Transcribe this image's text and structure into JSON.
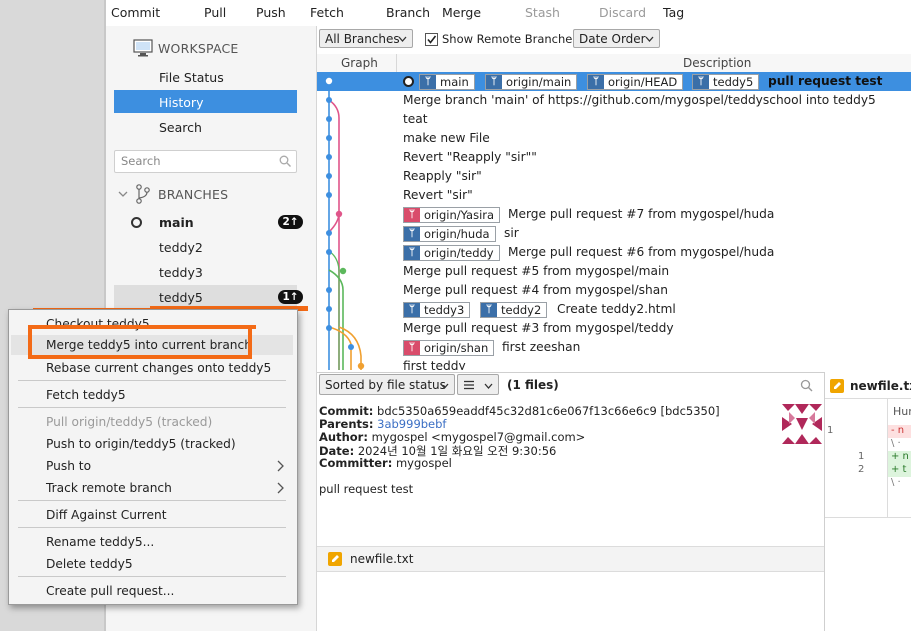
{
  "toolbar": {
    "items": [
      "Commit",
      "Pull",
      "Push",
      "Fetch",
      "Branch",
      "Merge",
      "Stash",
      "Discard",
      "Tag"
    ]
  },
  "sidebar": {
    "workspace_title": "WORKSPACE",
    "items": [
      "File Status",
      "History",
      "Search"
    ],
    "selected": "History",
    "search_placeholder": "Search",
    "branches_title": "BRANCHES",
    "branches": [
      {
        "name": "main",
        "current": true,
        "badge": "2↑"
      },
      {
        "name": "teddy2"
      },
      {
        "name": "teddy3"
      },
      {
        "name": "teddy5",
        "badge": "1↑"
      }
    ]
  },
  "filters": {
    "branches": "All Branches",
    "show_remote_label": "Show Remote Branches",
    "show_remote_checked": true,
    "order": "Date Order"
  },
  "columns": {
    "graph": "Graph",
    "description": "Description"
  },
  "commits": [
    {
      "tags": [
        {
          "label": "main",
          "kind": "local"
        },
        {
          "label": "origin/main",
          "kind": "remote"
        },
        {
          "label": "origin/HEAD",
          "kind": "remote"
        },
        {
          "label": "teddy5",
          "kind": "local"
        }
      ],
      "message": "pull request test",
      "selected": true
    },
    {
      "tags": [],
      "message": "Merge branch 'main' of https://github.com/mygospel/teddyschool into teddy5"
    },
    {
      "tags": [],
      "message": "teat"
    },
    {
      "tags": [],
      "message": "make new File"
    },
    {
      "tags": [],
      "message": "Revert \"Reapply \"sir\"\""
    },
    {
      "tags": [],
      "message": "Reapply \"sir\""
    },
    {
      "tags": [],
      "message": "Revert \"sir\""
    },
    {
      "tags": [
        {
          "label": "origin/Yasira",
          "kind": "other"
        }
      ],
      "message": "Merge pull request #7 from mygospel/huda"
    },
    {
      "tags": [
        {
          "label": "origin/huda",
          "kind": "remote"
        }
      ],
      "message": "sir"
    },
    {
      "tags": [
        {
          "label": "origin/teddy",
          "kind": "remote"
        }
      ],
      "message": "Merge pull request #6 from mygospel/huda"
    },
    {
      "tags": [],
      "message": "Merge pull request #5 from mygospel/main"
    },
    {
      "tags": [],
      "message": "Merge pull request #4 from mygospel/shan"
    },
    {
      "tags": [
        {
          "label": "teddy3",
          "kind": "local"
        },
        {
          "label": "teddy2",
          "kind": "local"
        }
      ],
      "message": "Create teddy2.html"
    },
    {
      "tags": [],
      "message": "Merge pull request #3 from mygospel/teddy"
    },
    {
      "tags": [
        {
          "label": "origin/shan",
          "kind": "other"
        }
      ],
      "message": "first zeeshan"
    },
    {
      "tags": [],
      "message": "first teddy"
    }
  ],
  "details": {
    "sort_label": "Sorted by file status",
    "files_count": "(1 files)",
    "commit_label": "Commit:",
    "commit_value": "bdc5350a659eaddf45c32d81c6e067f13c66e6c9 [bdc5350]",
    "parents_label": "Parents:",
    "parents_value": "3ab999bebf",
    "author_label": "Author:",
    "author_value": "mygospel <mygospel7@gmail.com>",
    "date_label": "Date:",
    "date_value": "2024년 10월 1일 화요일 오전 9:30:56",
    "committer_label": "Committer:",
    "committer_value": "mygospel",
    "message": "pull request test",
    "file": "newfile.txt"
  },
  "diff": {
    "file": "newfile.txt",
    "hunk": "Hun",
    "lines": [
      {
        "old": "1",
        "new": "",
        "text": "- n"
      },
      {
        "old": "",
        "new": "",
        "text": "\\ ·"
      },
      {
        "old": "",
        "new": "1",
        "text": "+ n"
      },
      {
        "old": "",
        "new": "2",
        "text": "+ t"
      },
      {
        "old": "",
        "new": "",
        "text": "\\ ·"
      }
    ]
  },
  "context_menu": {
    "items": [
      "Checkout teddy5...",
      "Merge teddy5 into current branch",
      "Rebase current changes onto teddy5",
      "Fetch teddy5",
      "Pull origin/teddy5 (tracked)",
      "Push to origin/teddy5 (tracked)",
      "Push to",
      "Track remote branch",
      "Diff Against Current",
      "Rename teddy5...",
      "Delete teddy5",
      "Create pull request..."
    ],
    "highlighted": "Merge teddy5 into current branch"
  },
  "colors": {
    "accent": "#3d8fe0",
    "annotation": "#f36a16",
    "graph_main": "#3d8fe0",
    "graph_pink": "#e0558a",
    "graph_green": "#5cb85c",
    "graph_orange": "#f0a030"
  }
}
